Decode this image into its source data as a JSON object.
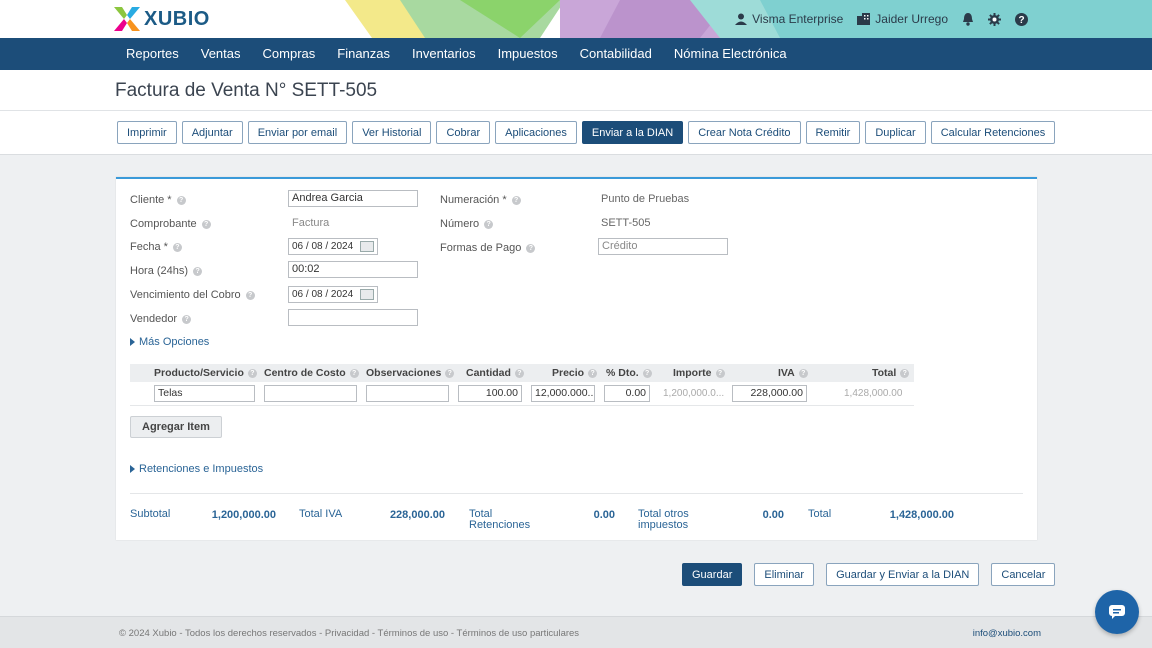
{
  "app": {
    "logo_text": "XUBIO"
  },
  "user_area": {
    "company": "Visma Enterprise",
    "user": "Jaider Urrego"
  },
  "nav": [
    "Reportes",
    "Ventas",
    "Compras",
    "Finanzas",
    "Inventarios",
    "Impuestos",
    "Contabilidad",
    "Nómina Electrónica"
  ],
  "page": {
    "title": "Factura de Venta N° SETT-505"
  },
  "toolbar": [
    "Imprimir",
    "Adjuntar",
    "Enviar por email",
    "Ver Historial",
    "Cobrar",
    "Aplicaciones",
    "Enviar a la DIAN",
    "Crear Nota Crédito",
    "Remitir",
    "Duplicar",
    "Calcular Retenciones"
  ],
  "form": {
    "cliente_label": "Cliente *",
    "cliente_value": "Andrea Garcia",
    "comprobante_label": "Comprobante",
    "comprobante_value": "Factura",
    "fecha_label": "Fecha *",
    "fecha_value": "06 / 08 / 2024",
    "hora_label": "Hora (24hs)",
    "hora_value": "00:02",
    "vencimiento_label": "Vencimiento del Cobro",
    "vencimiento_value": "06 / 08 / 2024",
    "vendedor_label": "Vendedor",
    "vendedor_value": "",
    "numeracion_label": "Numeración *",
    "numeracion_value": "Punto de Pruebas",
    "numero_label": "Número",
    "numero_value": "SETT-505",
    "formas_pago_label": "Formas de Pago",
    "formas_pago_value": "Crédito",
    "mas_opciones": "Más Opciones"
  },
  "items": {
    "headers": {
      "producto": "Producto/Servicio",
      "centro": "Centro de Costo",
      "observaciones": "Observaciones",
      "cantidad": "Cantidad",
      "precio": "Precio",
      "dto": "% Dto.",
      "importe": "Importe",
      "iva": "IVA",
      "total": "Total"
    },
    "row": {
      "producto": "Telas",
      "centro": "",
      "observaciones": "",
      "cantidad": "100.00",
      "precio": "12,000.000...",
      "dto": "0.00",
      "importe": "1,200,000.0...",
      "iva": "228,000.00",
      "total": "1,428,000.00"
    },
    "add_label": "Agregar Item"
  },
  "retenciones_link": "Retenciones e Impuestos",
  "totals": {
    "subtotal_label": "Subtotal",
    "subtotal_value": "1,200,000.00",
    "iva_label": "Total IVA",
    "iva_value": "228,000.00",
    "retenciones_label_1": "Total",
    "retenciones_label_2": "Retenciones",
    "retenciones_value": "0.00",
    "otros_label_1": "Total otros",
    "otros_label_2": "impuestos",
    "otros_value": "0.00",
    "total_label": "Total",
    "total_value": "1,428,000.00"
  },
  "actions": {
    "guardar": "Guardar",
    "eliminar": "Eliminar",
    "guardar_enviar": "Guardar y Enviar a la DIAN",
    "cancelar": "Cancelar"
  },
  "footer": {
    "left": "© 2024 Xubio - Todos los derechos reservados - Privacidad - Términos de uso - Términos de uso particulares",
    "email": "info@xubio.com"
  },
  "colors": {
    "primary": "#1c4d79",
    "accent": "#3a9ad9",
    "link": "#2a6496"
  }
}
